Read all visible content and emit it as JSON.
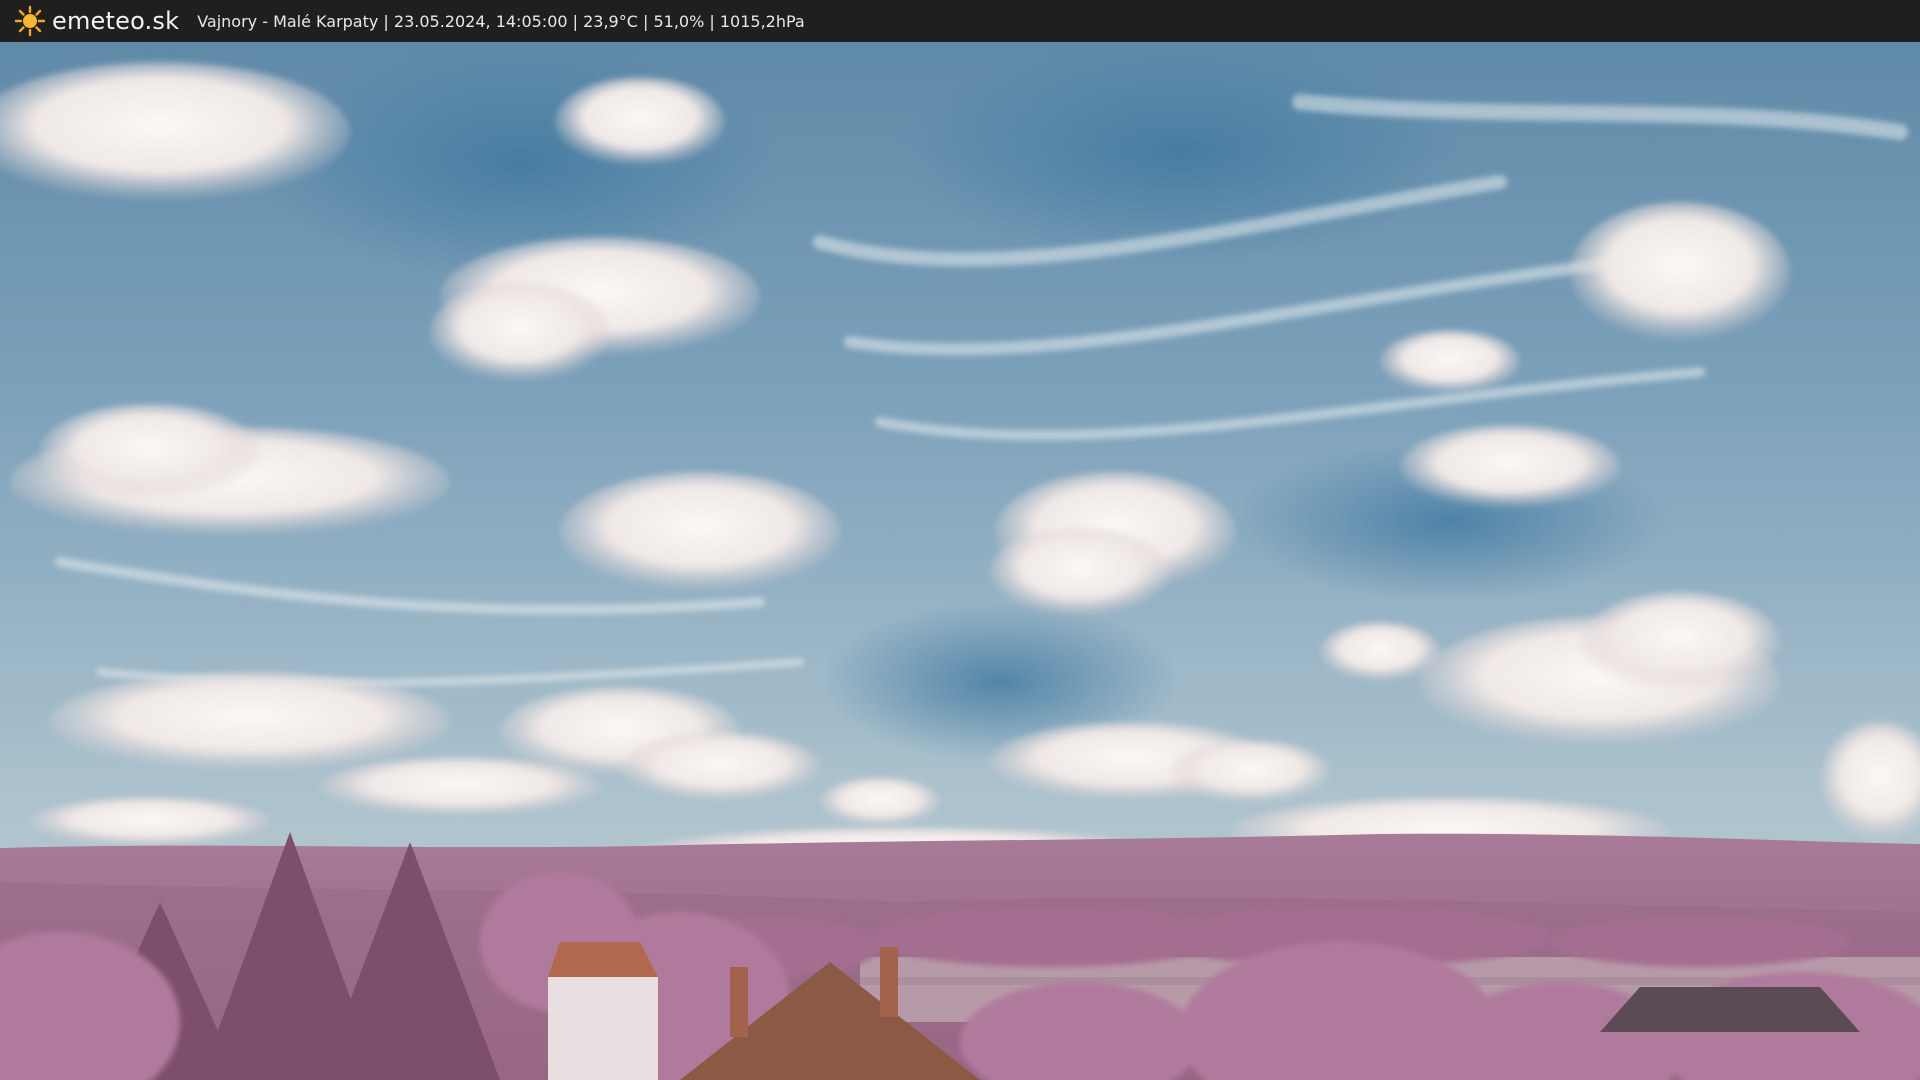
{
  "header": {
    "brand": "emeteo.sk",
    "logo_icon": "sun-icon",
    "info": "Vajnory - Malé Karpaty | 23.05.2024, 14:05:00 | 23,9°C | 51,0% | 1015,2hPa"
  },
  "colors": {
    "bar_background": "#1f1f1f",
    "sun": "#f5a623",
    "sky": "#6f98b3",
    "foliage": "#b07a9c"
  }
}
